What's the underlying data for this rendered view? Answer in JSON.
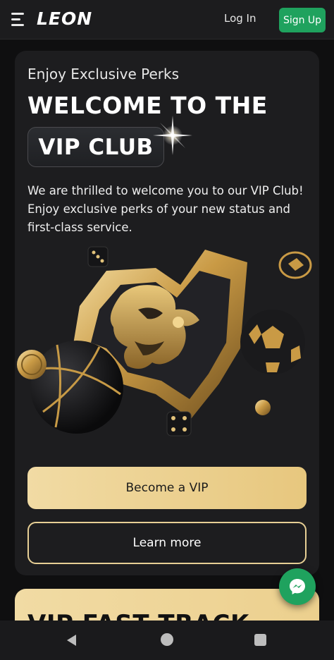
{
  "header": {
    "logo": "LEON",
    "login_label": "Log In",
    "signup_label": "Sign Up",
    "accent_color": "#1fa25e"
  },
  "vip": {
    "eyebrow": "Enjoy Exclusive Perks",
    "headline": "WELCOME TO THE",
    "badge": "VIP CLUB",
    "description": "We are thrilled to welcome you to our VIP Club! Enjoy exclusive perks of your new status and first-class service.",
    "primary_button": "Become a VIP",
    "secondary_button": "Learn more",
    "gold_color": "#e7c77e"
  },
  "next_card": {
    "title": "VIP FAST TRACK"
  },
  "icons": {
    "menu": "hamburger-menu-icon",
    "messenger": "chat-bubble-icon",
    "nav_back": "triangle-back-icon",
    "nav_home": "circle-home-icon",
    "nav_recent": "square-recent-icon"
  }
}
